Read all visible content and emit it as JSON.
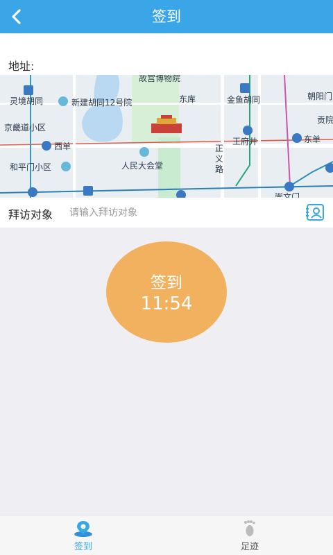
{
  "header": {
    "title": "签到",
    "back_icon": "chevron-left-icon"
  },
  "address": {
    "label": "地址:"
  },
  "map": {
    "pois": {
      "gugong": "故宫博物院",
      "dongku": "东库",
      "chaoyangmen": "朝阳门",
      "lingjing": "灵境胡同",
      "xinjian": "新建胡同12号院",
      "jinyu": "金鱼胡同",
      "gongzhu": "贡院",
      "jingjidao": "京畿道小区",
      "xidan": "西单",
      "wangfujing": "王府井",
      "dongdan": "东单",
      "zhengyilu": "正义路",
      "hepingmen": "和平门小区",
      "renmin": "人民大会堂",
      "chongwenmen": "崇文门"
    }
  },
  "visit": {
    "label": "拜访对象",
    "placeholder": "请输入拜访对象",
    "contact_icon": "contact-card-icon"
  },
  "checkin": {
    "label": "签到",
    "time": "11:54"
  },
  "nav": {
    "items": [
      {
        "label": "签到",
        "icon": "location-pin-icon",
        "active": true
      },
      {
        "label": "足迹",
        "icon": "footprint-icon",
        "active": false
      }
    ]
  },
  "colors": {
    "header": "#3aa6e8",
    "accent": "#38a8e2",
    "checkin": "#f2b15e",
    "background": "#efeef3"
  }
}
